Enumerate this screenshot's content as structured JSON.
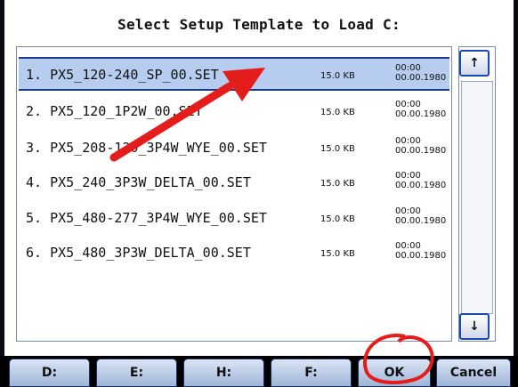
{
  "dialog": {
    "title": "Select Setup Template to Load C:",
    "files": [
      {
        "name": "1. PX5_120-240_SP_00.SET",
        "size": "15.0 KB",
        "time": "00:00",
        "date": "00.00.1980",
        "selected": true
      },
      {
        "name": "2. PX5_120_1P2W_00.SET",
        "size": "15.0 KB",
        "time": "00:00",
        "date": "00.00.1980",
        "selected": false
      },
      {
        "name": "3. PX5_208-120_3P4W_WYE_00.SET",
        "size": "15.0 KB",
        "time": "00:00",
        "date": "00.00.1980",
        "selected": false
      },
      {
        "name": "4. PX5_240_3P3W_DELTA_00.SET",
        "size": "15.0 KB",
        "time": "00:00",
        "date": "00.00.1980",
        "selected": false
      },
      {
        "name": "5. PX5_480-277_3P4W_WYE_00.SET",
        "size": "15.0 KB",
        "time": "00:00",
        "date": "00.00.1980",
        "selected": false
      },
      {
        "name": "6. PX5_480_3P3W_DELTA_00.SET",
        "size": "15.0 KB",
        "time": "00:00",
        "date": "00.00.1980",
        "selected": false
      }
    ]
  },
  "scrollbar": {
    "up_icon": "arrow-up-icon",
    "down_icon": "arrow-down-icon",
    "up_glyph": "↑",
    "down_glyph": "↓"
  },
  "toolbar": {
    "buttons": [
      {
        "label": "D:"
      },
      {
        "label": "E:"
      },
      {
        "label": "H:"
      },
      {
        "label": "F:"
      },
      {
        "label": "OK"
      },
      {
        "label": "Cancel"
      }
    ]
  },
  "colors": {
    "selection": "#b6cdef",
    "selection_border": "#1a3a8a",
    "annotation_red": "#e51c1c",
    "button_border": "#1a4ab0"
  }
}
